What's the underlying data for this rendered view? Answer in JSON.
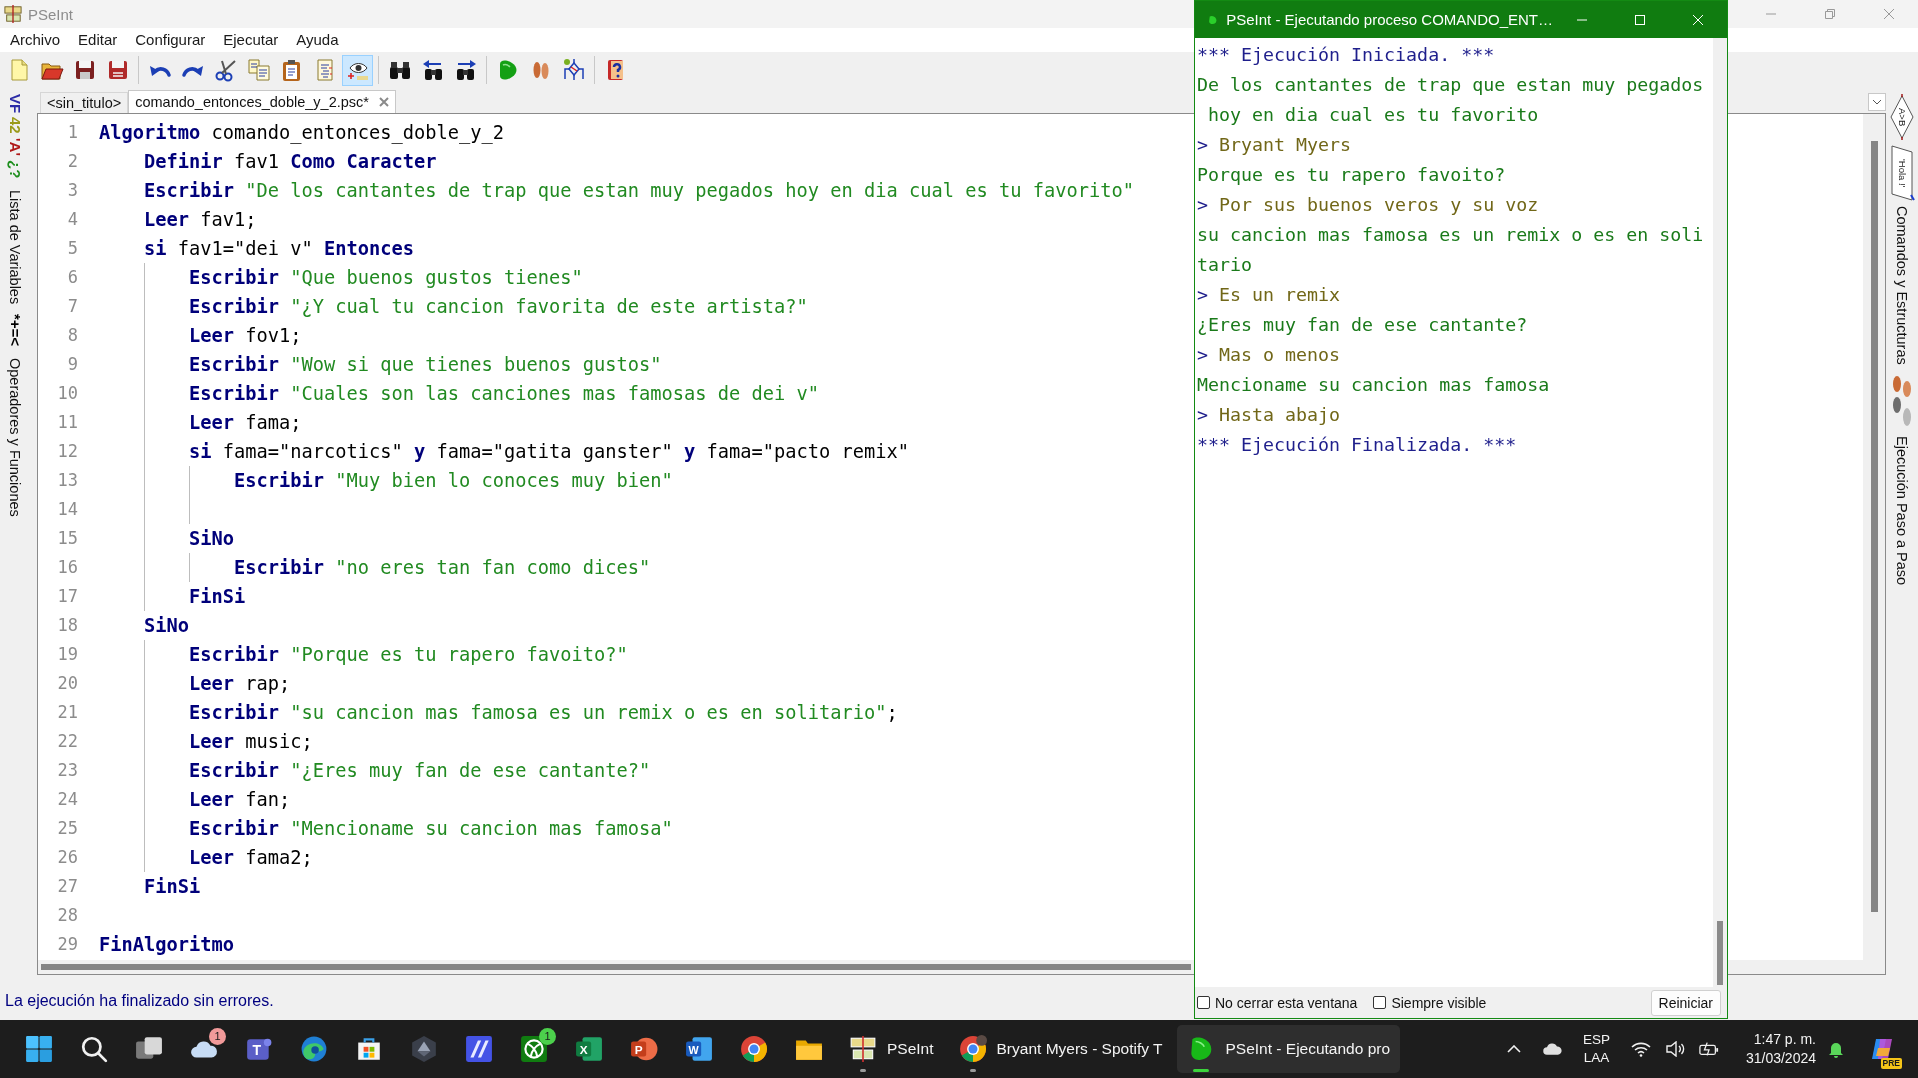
{
  "main_window": {
    "title": "PSeInt",
    "menu": [
      "Archivo",
      "Editar",
      "Configurar",
      "Ejecutar",
      "Ayuda"
    ],
    "toolbar": [
      [
        {
          "kind": "new",
          "on": false
        },
        {
          "kind": "open",
          "on": false
        },
        {
          "kind": "save",
          "on": false
        },
        {
          "kind": "save-as",
          "on": false
        }
      ],
      [
        {
          "kind": "undo",
          "on": false
        },
        {
          "kind": "redo",
          "on": false
        },
        {
          "kind": "cut",
          "on": false
        },
        {
          "kind": "copy",
          "on": false
        },
        {
          "kind": "paste",
          "on": false
        },
        {
          "kind": "format",
          "on": false
        },
        {
          "kind": "watch",
          "on": true
        }
      ],
      [
        {
          "kind": "find",
          "on": false
        },
        {
          "kind": "find-previous",
          "on": false
        },
        {
          "kind": "find-next",
          "on": false
        }
      ],
      [
        {
          "kind": "run",
          "on": false
        },
        {
          "kind": "step",
          "on": false
        },
        {
          "kind": "diagram",
          "on": false
        }
      ],
      [
        {
          "kind": "help",
          "on": false
        }
      ]
    ],
    "left_panel": [
      {
        "glyphs": [
          {
            "text": "VF",
            "color": "#2b2ba6"
          },
          {
            "text": "42",
            "color": "#9a9a1a"
          },
          {
            "text": "'A'",
            "color": "#b01818"
          },
          {
            "text": "¿?",
            "color": "#1f8f1f"
          }
        ],
        "label": "Lista de Variables"
      },
      {
        "glyphs": [
          {
            "text": "*+=<",
            "color": "#000000"
          }
        ],
        "label": "Operadores y Funciones"
      }
    ],
    "tabs": [
      {
        "label": "<sin_titulo>",
        "selected": false,
        "closable": false
      },
      {
        "label": "comando_entonces_doble_y_2.psc*",
        "selected": true,
        "closable": true
      }
    ],
    "editor": {
      "lines": [
        {
          "number": "1",
          "tokens": [
            {
              "kind": "keyword",
              "text": "Algoritmo"
            },
            {
              "kind": "text",
              "text": " comando_entonces_doble_y_2"
            }
          ],
          "children": [
            {
              "number": "2",
              "tokens": [
                {
                  "kind": "keyword",
                  "text": "Definir"
                },
                {
                  "kind": "text",
                  "text": " fav1 "
                },
                {
                  "kind": "keyword",
                  "text": "Como Caracter"
                }
              ]
            },
            {
              "number": "3",
              "tokens": [
                {
                  "kind": "keyword",
                  "text": "Escribir"
                },
                {
                  "kind": "string",
                  "text": " \"De los cantantes de trap que estan muy pegados hoy en dia cual es tu favorito\""
                }
              ]
            },
            {
              "number": "4",
              "tokens": [
                {
                  "kind": "keyword",
                  "text": "Leer"
                },
                {
                  "kind": "text",
                  "text": " fav1;"
                }
              ]
            },
            {
              "number": "5",
              "tokens": [
                {
                  "kind": "keyword",
                  "text": "si"
                },
                {
                  "kind": "text",
                  "text": " fav1=\"dei v\" "
                },
                {
                  "kind": "keyword",
                  "text": "Entonces"
                }
              ],
              "children": [
                {
                  "number": "6",
                  "tokens": [
                    {
                      "kind": "keyword",
                      "text": "Escribir"
                    },
                    {
                      "kind": "string",
                      "text": " \"Que buenos gustos tienes\""
                    }
                  ]
                },
                {
                  "number": "7",
                  "tokens": [
                    {
                      "kind": "keyword",
                      "text": "Escribir"
                    },
                    {
                      "kind": "string",
                      "text": " \"¿Y cual tu cancion favorita de este artista?\""
                    }
                  ]
                },
                {
                  "number": "8",
                  "tokens": [
                    {
                      "kind": "keyword",
                      "text": "Leer"
                    },
                    {
                      "kind": "text",
                      "text": " fov1;"
                    }
                  ]
                },
                {
                  "number": "9",
                  "tokens": [
                    {
                      "kind": "keyword",
                      "text": "Escribir"
                    },
                    {
                      "kind": "string",
                      "text": " \"Wow si que tienes buenos gustos\""
                    }
                  ]
                },
                {
                  "number": "10",
                  "tokens": [
                    {
                      "kind": "keyword",
                      "text": "Escribir"
                    },
                    {
                      "kind": "string",
                      "text": " \"Cuales son las canciones mas famosas de dei v\""
                    }
                  ]
                },
                {
                  "number": "11",
                  "tokens": [
                    {
                      "kind": "keyword",
                      "text": "Leer"
                    },
                    {
                      "kind": "text",
                      "text": " fama;"
                    }
                  ]
                },
                {
                  "number": "12",
                  "tokens": [
                    {
                      "kind": "keyword",
                      "text": "si"
                    },
                    {
                      "kind": "text",
                      "text": " fama=\"narcotics\" "
                    },
                    {
                      "kind": "keyword",
                      "text": "y"
                    },
                    {
                      "kind": "text",
                      "text": " fama=\"gatita ganster\" "
                    },
                    {
                      "kind": "keyword",
                      "text": "y"
                    },
                    {
                      "kind": "text",
                      "text": " fama=\"pacto remix\""
                    }
                  ],
                  "children": [
                    {
                      "number": "13",
                      "tokens": [
                        {
                          "kind": "keyword",
                          "text": "Escribir"
                        },
                        {
                          "kind": "string",
                          "text": " \"Muy bien lo conoces muy bien\""
                        }
                      ]
                    },
                    {
                      "number": "14"
                    }
                  ]
                },
                {
                  "number": "15",
                  "tokens": [
                    {
                      "kind": "keyword",
                      "text": "SiNo"
                    }
                  ],
                  "children": [
                    {
                      "number": "16",
                      "tokens": [
                        {
                          "kind": "keyword",
                          "text": "Escribir"
                        },
                        {
                          "kind": "string",
                          "text": " \"no eres tan fan como dices\""
                        }
                      ]
                    }
                  ]
                },
                {
                  "number": "17",
                  "tokens": [
                    {
                      "kind": "keyword",
                      "text": "FinSi"
                    }
                  ]
                }
              ]
            },
            {
              "number": "18",
              "tokens": [
                {
                  "kind": "keyword",
                  "text": "SiNo"
                }
              ],
              "children": [
                {
                  "number": "19",
                  "tokens": [
                    {
                      "kind": "keyword",
                      "text": "Escribir"
                    },
                    {
                      "kind": "string",
                      "text": " \"Porque es tu rapero favoito?\""
                    }
                  ]
                },
                {
                  "number": "20",
                  "tokens": [
                    {
                      "kind": "keyword",
                      "text": "Leer"
                    },
                    {
                      "kind": "text",
                      "text": " rap;"
                    }
                  ]
                },
                {
                  "number": "21",
                  "tokens": [
                    {
                      "kind": "keyword",
                      "text": "Escribir"
                    },
                    {
                      "kind": "string",
                      "text": " \"su cancion mas famosa es un remix o es en solitario\""
                    },
                    {
                      "kind": "text",
                      "text": ";"
                    }
                  ]
                },
                {
                  "number": "22",
                  "tokens": [
                    {
                      "kind": "keyword",
                      "text": "Leer"
                    },
                    {
                      "kind": "text",
                      "text": " music;"
                    }
                  ]
                },
                {
                  "number": "23",
                  "tokens": [
                    {
                      "kind": "keyword",
                      "text": "Escribir"
                    },
                    {
                      "kind": "string",
                      "text": " \"¿Eres muy fan de ese cantante?\""
                    }
                  ]
                },
                {
                  "number": "24",
                  "tokens": [
                    {
                      "kind": "keyword",
                      "text": "Leer"
                    },
                    {
                      "kind": "text",
                      "text": " fan;"
                    }
                  ]
                },
                {
                  "number": "25",
                  "tokens": [
                    {
                      "kind": "keyword",
                      "text": "Escribir"
                    },
                    {
                      "kind": "string",
                      "text": " \"Mencioname su cancion mas famosa\""
                    }
                  ]
                },
                {
                  "number": "26",
                  "tokens": [
                    {
                      "kind": "keyword",
                      "text": "Leer"
                    },
                    {
                      "kind": "text",
                      "text": " fama2;"
                    }
                  ]
                }
              ]
            },
            {
              "number": "27",
              "tokens": [
                {
                  "kind": "keyword",
                  "text": "FinSi"
                }
              ]
            },
            {
              "number": "28"
            }
          ]
        },
        {
          "number": "29",
          "tokens": [
            {
              "kind": "keyword",
              "text": "FinAlgoritmo"
            }
          ]
        }
      ]
    },
    "right_panel": [
      {
        "kind": "commands",
        "icon_labels": [
          "A>B",
          "'Hola !'"
        ],
        "label": "Comandos y Estructuras"
      },
      {
        "kind": "step",
        "label": "Ejecución Paso a Paso"
      }
    ],
    "status": "La ejecución ha finalizado sin errores."
  },
  "run_window": {
    "title": "PSeInt - Ejecutando proceso COMANDO_ENT…",
    "console": [
      {
        "kind": "system",
        "text": "*** Ejecución Iniciada. ***"
      },
      {
        "kind": "output",
        "text": "De los cantantes de trap que estan muy pegados hoy en dia cual es tu favorito"
      },
      {
        "kind": "input",
        "prompt": ">",
        "text": "Bryant Myers"
      },
      {
        "kind": "output",
        "text": "Porque es tu rapero favoito?"
      },
      {
        "kind": "input",
        "prompt": ">",
        "text": "Por sus buenos veros y su voz"
      },
      {
        "kind": "output",
        "text": "su cancion mas famosa es un remix o es en solitario"
      },
      {
        "kind": "input",
        "prompt": ">",
        "text": "Es un remix"
      },
      {
        "kind": "output",
        "text": "¿Eres muy fan de ese cantante?"
      },
      {
        "kind": "input",
        "prompt": ">",
        "text": "Mas o menos"
      },
      {
        "kind": "output",
        "text": "Mencioname su cancion mas famosa"
      },
      {
        "kind": "input",
        "prompt": ">",
        "text": "Hasta abajo"
      },
      {
        "kind": "system",
        "text": "*** Ejecución Finalizada. ***"
      }
    ],
    "options": [
      {
        "label": "No cerrar esta ventana",
        "checked": false
      },
      {
        "label": "Siempre visible",
        "checked": false
      }
    ],
    "button": "Reiniciar"
  },
  "taskbar": {
    "apps": [
      {
        "kind": "start",
        "running": false,
        "active": false
      },
      {
        "kind": "search",
        "running": false,
        "active": false
      },
      {
        "kind": "task-view",
        "running": false,
        "active": false
      },
      {
        "kind": "cloud",
        "badge": "1",
        "running": false,
        "active": false
      },
      {
        "kind": "teams",
        "glyph": "T",
        "running": false,
        "active": false
      },
      {
        "kind": "edge",
        "running": false,
        "active": false
      },
      {
        "kind": "store",
        "running": false,
        "active": false
      },
      {
        "kind": "hexagon",
        "running": false,
        "active": false
      },
      {
        "kind": "m-app",
        "running": false,
        "active": false
      },
      {
        "kind": "xbox",
        "badge": "1",
        "running": false,
        "active": false
      },
      {
        "kind": "excel",
        "glyph": "X",
        "running": false,
        "active": false
      },
      {
        "kind": "powerpoint",
        "glyph": "P",
        "running": false,
        "active": false
      },
      {
        "kind": "word",
        "glyph": "W",
        "running": false,
        "active": false
      },
      {
        "kind": "chrome",
        "running": false,
        "active": false
      },
      {
        "kind": "folder",
        "running": false,
        "active": false
      },
      {
        "kind": "pseint",
        "label": "PSeInt",
        "running": true,
        "active": false
      },
      {
        "kind": "chrome-profile",
        "label": "Bryant Myers - Spotify T",
        "running": true,
        "active": false
      },
      {
        "kind": "pseint-run",
        "label": "PSeInt - Ejecutando pro",
        "running": true,
        "active": true
      }
    ],
    "tray": {
      "language": [
        "ESP",
        "LAA"
      ],
      "time": "1:47 p. m.",
      "date": "31/03/2024",
      "copilot_badge": "PRE"
    }
  }
}
